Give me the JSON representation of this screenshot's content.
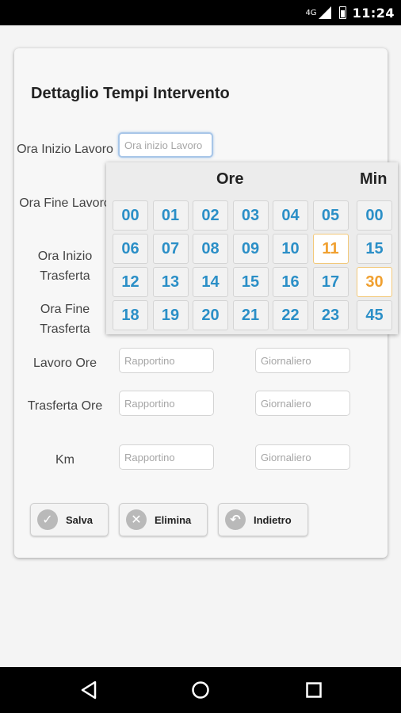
{
  "status_bar": {
    "network": "4G",
    "time": "11:24"
  },
  "form": {
    "title": "Dettaglio Tempi Intervento",
    "labels": {
      "ora_inizio_lavoro": "Ora Inizio Lavoro",
      "ora_fine_lavoro": "Ora Fine Lavoro",
      "ora_inizio_trasferta": "Ora Inizio Trasferta",
      "ora_fine_trasferta": "Ora Fine Trasferta",
      "lavoro_ore": "Lavoro Ore",
      "trasferta_ore": "Trasferta Ore",
      "km": "Km"
    },
    "placeholders": {
      "ora_inizio_lavoro": "Ora inizio Lavoro",
      "rapportino": "Rapportino",
      "giornaliero": "Giornaliero"
    },
    "buttons": {
      "salva": "Salva",
      "elimina": "Elimina",
      "indietro": "Indietro"
    }
  },
  "time_picker": {
    "hours_header": "Ore",
    "minutes_header": "Min",
    "hours": [
      "00",
      "01",
      "02",
      "03",
      "04",
      "05",
      "06",
      "07",
      "08",
      "09",
      "10",
      "11",
      "12",
      "13",
      "14",
      "15",
      "16",
      "17",
      "18",
      "19",
      "20",
      "21",
      "22",
      "23"
    ],
    "minutes": [
      "00",
      "15",
      "30",
      "45"
    ],
    "selected_hour": "11",
    "selected_minute": "30",
    "colors": {
      "normal": "#2b8fc7",
      "selected": "#f0a030"
    }
  },
  "icons": {
    "salva": "check-circle-icon",
    "elimina": "close-circle-icon",
    "indietro": "undo-circle-icon",
    "nav": [
      "back-icon",
      "home-icon",
      "recents-icon"
    ]
  }
}
